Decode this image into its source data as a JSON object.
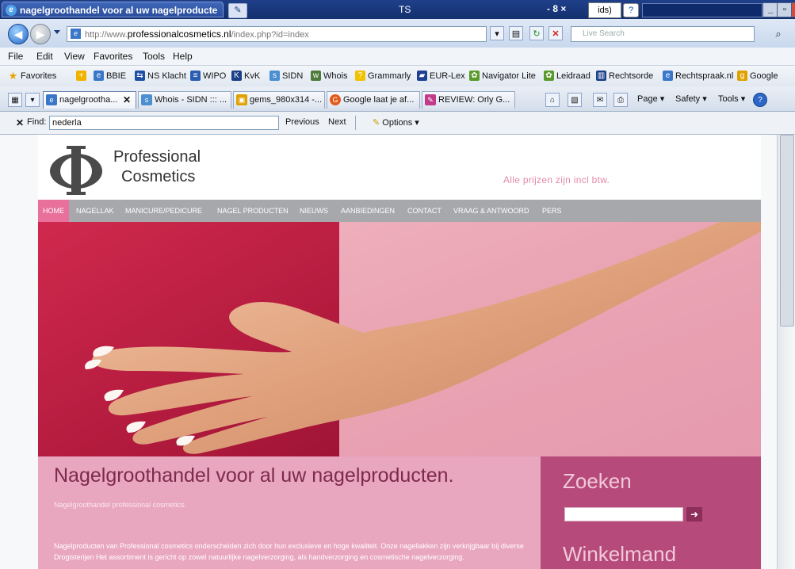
{
  "browser": {
    "active_tab_title": "nagelgroothandel voor al uw nagelproducte",
    "titlebar_center": "TS",
    "titlebar_controls": "- 8 ×",
    "titlebar_ids": "ids)",
    "url_prefix": "http://www.",
    "url_domain": "professionalcosmetics.nl",
    "url_path": "/index.php?id=index",
    "search_placeholder": "Live Search",
    "menu": [
      "File",
      "Edit",
      "View",
      "Favorites",
      "Tools",
      "Help"
    ],
    "favorites_label": "Favorites",
    "favorites": [
      "BBIE",
      "NS Klacht",
      "WIPO",
      "KvK",
      "SIDN",
      "Whois",
      "Grammarly",
      "EUR-Lex",
      "Navigator Lite",
      "Leidraad",
      "Rechtsorde",
      "Rechtspraak.nl",
      "Google"
    ],
    "tabs": [
      "nagelgrootha...",
      "Whois - SIDN ::: ...",
      "gems_980x314 -...",
      "Google laat je af...",
      "REVIEW: Orly G..."
    ],
    "commands": [
      "Page ▾",
      "Safety ▾",
      "Tools ▾"
    ],
    "find": {
      "label": "Find:",
      "value": "nederla",
      "previous": "Previous",
      "next": "Next",
      "options": "Options ▾"
    }
  },
  "site": {
    "logo_line1": "Professional",
    "logo_line2": "Cosmetics",
    "prices_note": "Alle prijzen zijn incl btw.",
    "nav": [
      "HOME",
      "NAGELLAK",
      "MANICURE/PEDICURE",
      "NAGEL PRODUCTEN",
      "NIEUWS",
      "AANBIEDINGEN",
      "CONTACT",
      "VRAAG & ANTWOORD",
      "PERS"
    ],
    "headline": "Nagelgroothandel voor al uw nagelproducten.",
    "subheadline": "Nagelgroothandel professional cosmetics.",
    "body_text": "Nagelproducten van Professional cosmetics onderscheiden zich door hun exclusieve en hoge kwaliteit. Onze nagellakken zijn verkrijgbaar bij diverse Drogisterijen Het assortiment is gericht op zowel natuurlijke nagelverzorging, als handverzorging en cosmetische nagelverzorging.",
    "search_title": "Zoeken",
    "search_button": "➜",
    "cart_title": "Winkelmand"
  },
  "colors": {
    "accent_pink": "#e8709a",
    "sidebar": "#b54a7b",
    "intro_bg": "#e9a6bf",
    "nav_bg": "#a7a8ab"
  }
}
